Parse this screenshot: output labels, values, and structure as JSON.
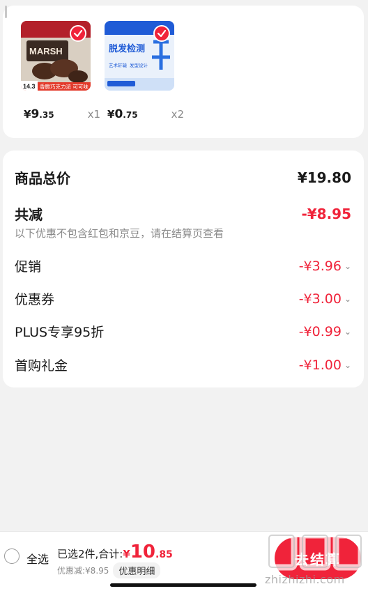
{
  "products": [
    {
      "name": "chocolate-pie",
      "thumb_caption": "香脆巧克力派 可可味",
      "thumb_price_tag": "14.3",
      "thumb_text": "MARSH",
      "price_currency": "¥",
      "price_int": "9",
      "price_dec": ".35",
      "qty": "x1"
    },
    {
      "name": "hair-test",
      "thumb_title": "脱发检测",
      "thumb_sub": "艺术轩辕",
      "thumb_sub2": "发型设计",
      "price_currency": "¥",
      "price_int": "0",
      "price_dec": ".75",
      "qty": "x2"
    }
  ],
  "summary": {
    "total_label": "商品总价",
    "total_value": "¥19.80",
    "reduce_label": "共减",
    "reduce_value": "-¥8.95",
    "note": "以下优惠不包含红包和京豆，请在结算页查看",
    "items": [
      {
        "label": "促销",
        "value": "-¥3.96"
      },
      {
        "label": "优惠券",
        "value": "-¥3.00"
      },
      {
        "label": "PLUS专享95折",
        "value": "-¥0.99"
      },
      {
        "label": "首购礼金",
        "value": "-¥1.00"
      }
    ]
  },
  "bottom_bar": {
    "select_all": "全选",
    "selected_text": "已选2件,合计:",
    "total_currency": "¥",
    "total_int": "10",
    "total_dec": ".85",
    "discount_text": "优惠减:¥8.95",
    "detail_label": "优惠明细",
    "checkout_label": "去结算"
  },
  "watermark": {
    "logo_text": "值值值",
    "site": "zhizhizhi.com"
  },
  "colors": {
    "accent": "#f0233a",
    "background": "#f2f2f2",
    "card": "#ffffff",
    "muted": "#8a8a8a"
  },
  "icons": [
    "check-icon",
    "chevron-down-icon",
    "radio-icon"
  ]
}
